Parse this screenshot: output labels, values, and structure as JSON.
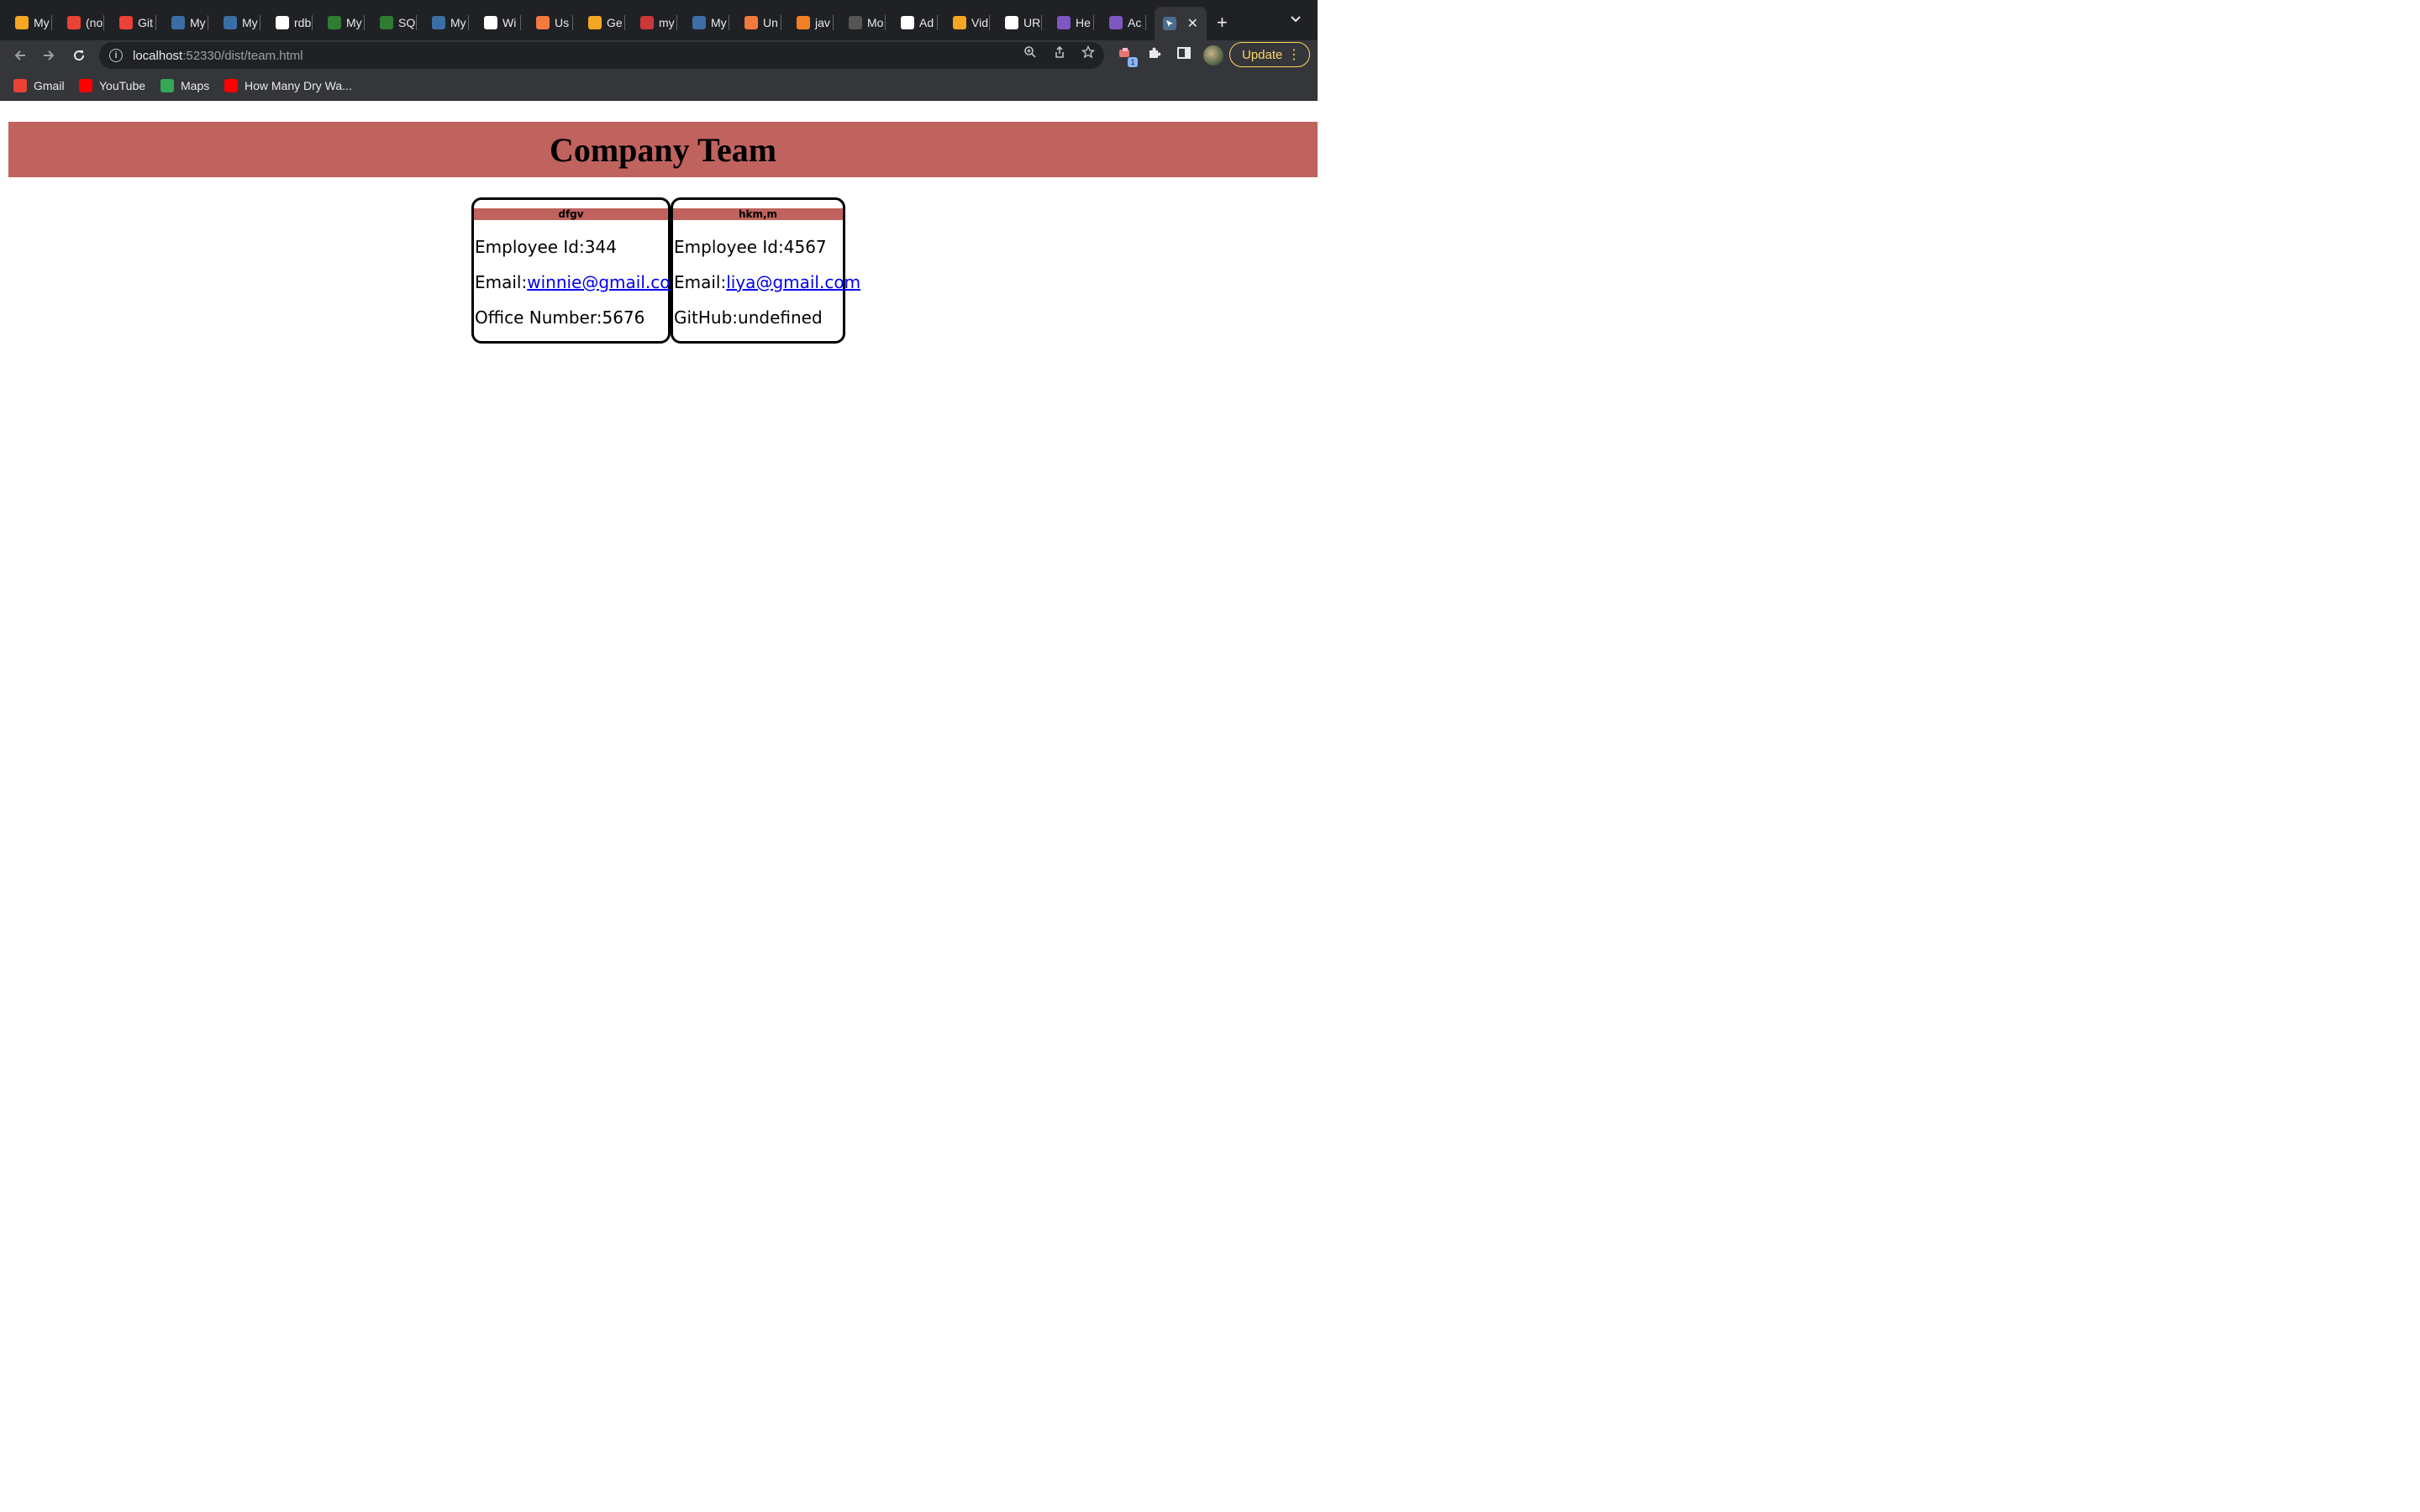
{
  "browser": {
    "tabs": [
      {
        "label": "My",
        "icon": "fs-icon",
        "color": "#f5a623"
      },
      {
        "label": "(no",
        "icon": "gmail-icon",
        "color": "#ea4335"
      },
      {
        "label": "Git",
        "icon": "gmail-icon",
        "color": "#ea4335"
      },
      {
        "label": "My",
        "icon": "mysql-icon",
        "color": "#3b6ea5"
      },
      {
        "label": "My",
        "icon": "mysql-icon",
        "color": "#3b6ea5"
      },
      {
        "label": "rdb",
        "icon": "google-icon",
        "color": "#ffffff"
      },
      {
        "label": "My",
        "icon": "w3-icon",
        "color": "#2e7d32"
      },
      {
        "label": "SQ",
        "icon": "w3-icon",
        "color": "#2e7d32"
      },
      {
        "label": "My",
        "icon": "mysql-icon",
        "color": "#3b6ea5"
      },
      {
        "label": "Wi",
        "icon": "github-icon",
        "color": "#ffffff"
      },
      {
        "label": "Us",
        "icon": "gitlab-icon",
        "color": "#f27a3d"
      },
      {
        "label": "Ge",
        "icon": "fs-icon",
        "color": "#f5a623"
      },
      {
        "label": "my",
        "icon": "npm-icon",
        "color": "#cb3837"
      },
      {
        "label": "My",
        "icon": "mysql-icon",
        "color": "#3b6ea5"
      },
      {
        "label": "Un",
        "icon": "gitlab-icon",
        "color": "#f27a3d"
      },
      {
        "label": "jav",
        "icon": "stackoverflow-icon",
        "color": "#f48024"
      },
      {
        "label": "Mo",
        "icon": "page-icon",
        "color": "#555555"
      },
      {
        "label": "Ad",
        "icon": "github-icon",
        "color": "#ffffff"
      },
      {
        "label": "Vid",
        "icon": "fs-icon",
        "color": "#f5a623"
      },
      {
        "label": "UR",
        "icon": "medium-icon",
        "color": "#ffffff"
      },
      {
        "label": "He",
        "icon": "heroku-icon",
        "color": "#7e57c2"
      },
      {
        "label": "Ac",
        "icon": "heroku-icon",
        "color": "#7e57c2"
      }
    ],
    "active_tab_icon": "globe-icon",
    "url_host": "localhost",
    "url_rest": ":52330/dist/team.html",
    "update_label": "Update",
    "extension_badge": "1",
    "bookmarks": [
      {
        "label": "Gmail",
        "icon": "gmail-icon",
        "color": "#ea4335"
      },
      {
        "label": "YouTube",
        "icon": "youtube-icon",
        "color": "#ff0000"
      },
      {
        "label": "Maps",
        "icon": "maps-icon",
        "color": "#34a853"
      },
      {
        "label": "How Many Dry Wa...",
        "icon": "youtube-icon",
        "color": "#ff0000"
      }
    ]
  },
  "page": {
    "title": "Company Team",
    "header_color": "#c0635f",
    "employees": [
      {
        "name": "dfgv",
        "id_label": "Employee Id:",
        "id": "344",
        "email_label": "Email:",
        "email": "winnie@gmail.com",
        "extra_label": "Office Number:",
        "extra": "5676"
      },
      {
        "name": "hkm,m",
        "id_label": "Employee Id:",
        "id": "4567",
        "email_label": "Email:",
        "email": "liya@gmail.com",
        "extra_label": "GitHub:",
        "extra": "undefined"
      }
    ]
  }
}
